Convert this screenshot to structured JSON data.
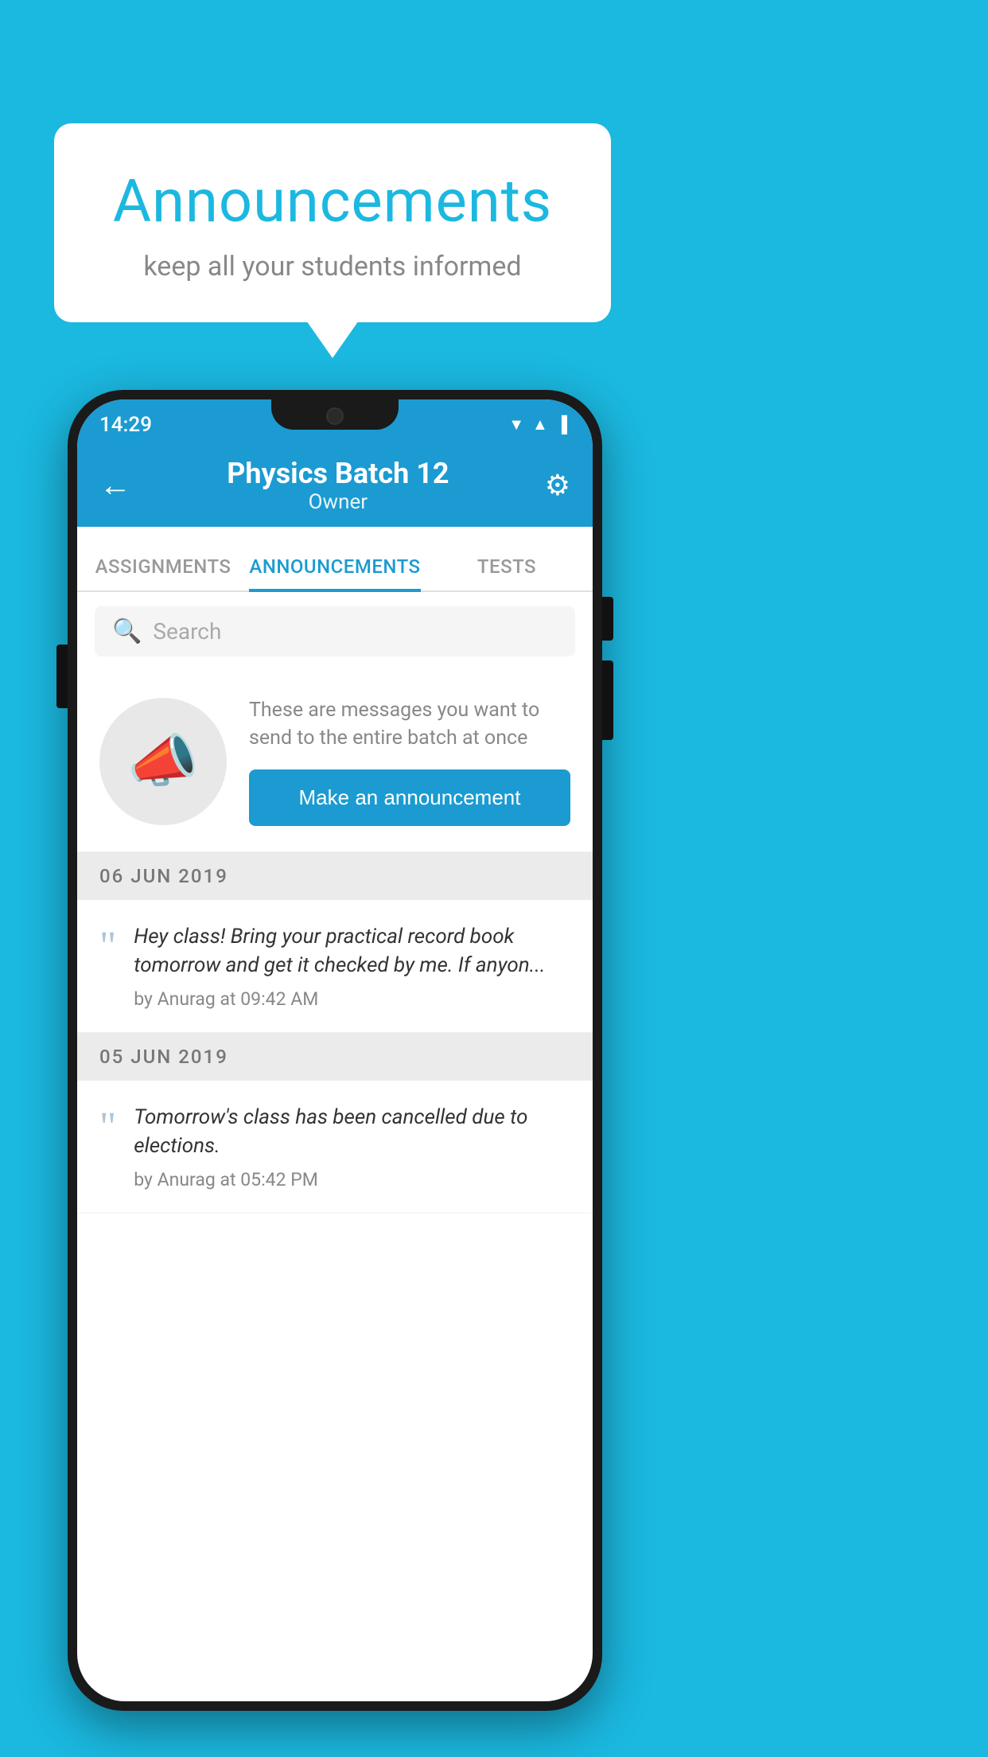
{
  "background_color": "#1bb8e0",
  "speech_bubble": {
    "title": "Announcements",
    "subtitle": "keep all your students informed"
  },
  "phone": {
    "status_bar": {
      "time": "14:29",
      "wifi": "▲",
      "signal": "▲",
      "battery": "▐"
    },
    "app_bar": {
      "back_label": "←",
      "title": "Physics Batch 12",
      "subtitle": "Owner",
      "settings_icon": "⚙"
    },
    "tabs": [
      {
        "label": "ASSIGNMENTS",
        "active": false
      },
      {
        "label": "ANNOUNCEMENTS",
        "active": true
      },
      {
        "label": "TESTS",
        "active": false
      }
    ],
    "search": {
      "placeholder": "Search"
    },
    "announcement_prompt": {
      "description": "These are messages you want to send to the entire batch at once",
      "button_label": "Make an announcement"
    },
    "date_sections": [
      {
        "date": "06  JUN  2019",
        "items": [
          {
            "text": "Hey class! Bring your practical record book tomorrow and get it checked by me. If anyon...",
            "author": "by Anurag at 09:42 AM"
          }
        ]
      },
      {
        "date": "05  JUN  2019",
        "items": [
          {
            "text": "Tomorrow's class has been cancelled due to elections.",
            "author": "by Anurag at 05:42 PM"
          }
        ]
      }
    ]
  }
}
